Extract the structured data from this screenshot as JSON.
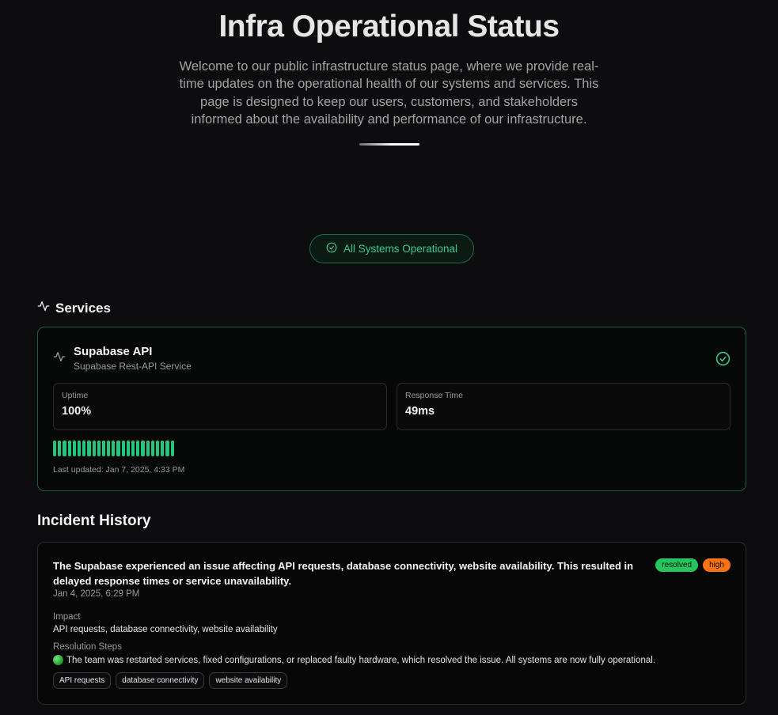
{
  "header": {
    "title": "Infra Operational Status",
    "description": "Welcome to our public infrastructure status page, where we provide real-time updates on the operational health of our systems and services. This page is designed to keep our users, customers, and stakeholders informed about the availability and performance of our infrastructure."
  },
  "overall_status": {
    "label": "All Systems Operational",
    "icon": "check-circle-icon"
  },
  "services_section": {
    "title": "Services",
    "icon": "activity-icon",
    "service": {
      "name": "Supabase API",
      "description": "Supabase Rest-API Service",
      "status_icon": "check-circle-icon",
      "uptime_label": "Uptime",
      "uptime_value": "100%",
      "response_label": "Response Time",
      "response_value": "49ms",
      "history_bar_count": 25,
      "history_color": "#22c77e",
      "last_updated": "Last updated: Jan 7, 2025, 4:33 PM"
    }
  },
  "incident_section": {
    "title": "Incident History",
    "incident": {
      "summary": "The Supabase experienced an issue affecting API requests, database connectivity, website availability. This resulted in delayed response times or service unavailability.",
      "status_badge": "resolved",
      "severity_badge": "high",
      "date": "Jan 4, 2025, 6:29 PM",
      "impact_label": "Impact",
      "impact_value": "API requests, database connectivity, website availability",
      "resolution_label": "Resolution Steps",
      "resolution_value": "The team was restarted services, fixed configurations, or replaced faulty hardware, which resolved the issue. All systems are now fully operational.",
      "tags": [
        "API requests",
        "database connectivity",
        "website availability"
      ]
    }
  },
  "colors": {
    "accent_green": "#34c98a",
    "resolved": "#22c55e",
    "high": "#f97316"
  }
}
